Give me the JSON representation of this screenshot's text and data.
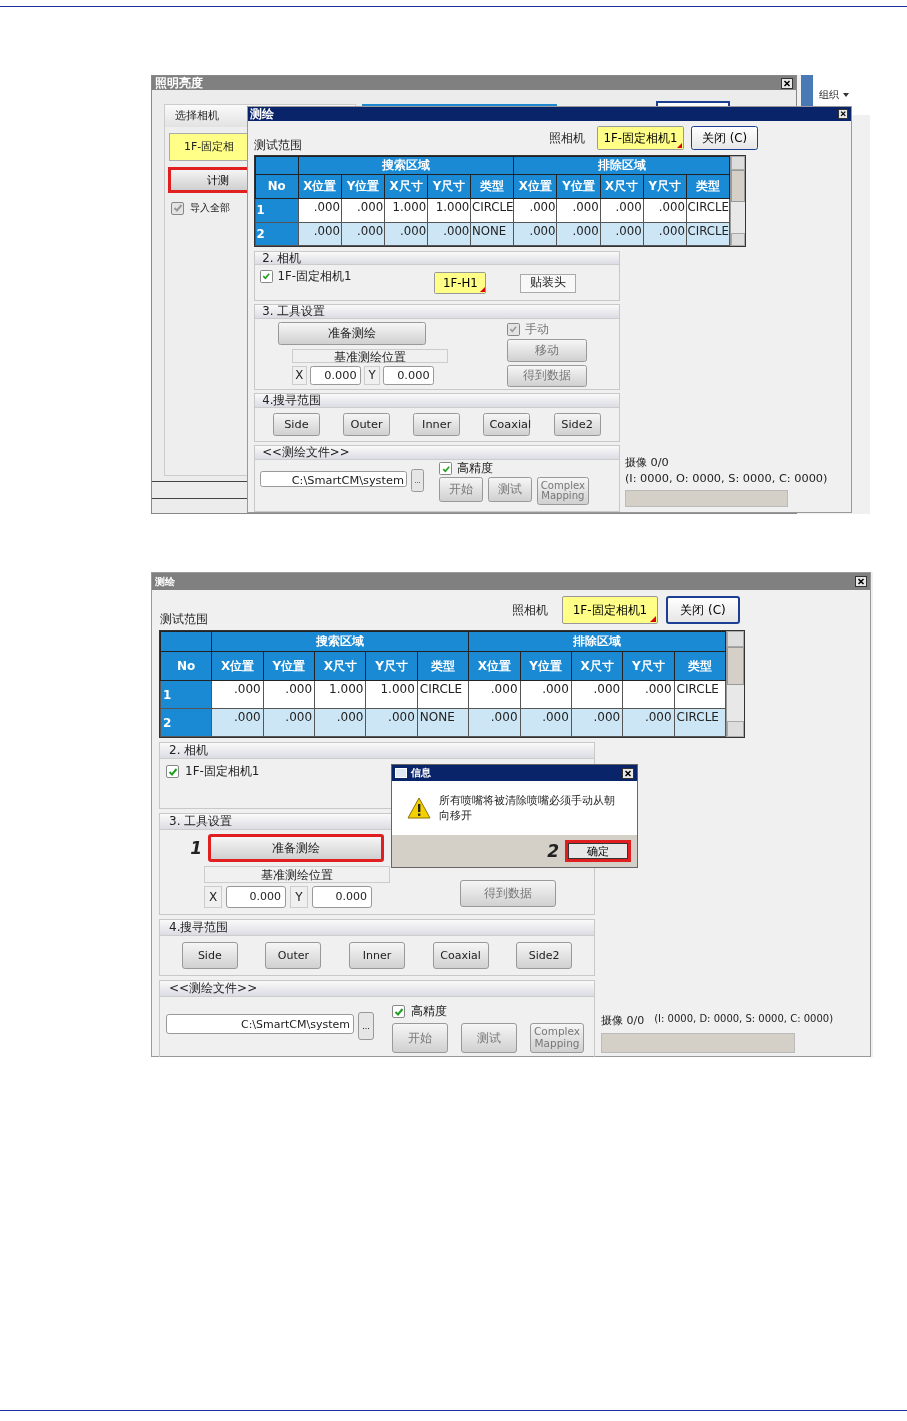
{
  "screenshots": [
    {
      "background_window": {
        "title": "照明亮度",
        "section_title": "选择相机",
        "camera": "1F-固定相",
        "measure_button": {
          "label": "计测",
          "highlighted": true
        },
        "import_all": {
          "label": "导入全部",
          "checked": true,
          "disabled": true
        }
      },
      "side_window": {
        "menu": "组织"
      },
      "dialog": {
        "title": "测绘",
        "active": true,
        "range_label": "测试范围",
        "camera_label": "照相机",
        "camera_value": "1F-固定相机1",
        "close_button": "关闭 (C)",
        "table": {
          "groups": [
            "搜索区域",
            "排除区域"
          ],
          "columns": [
            "No",
            "X位置",
            "Y位置",
            "X尺寸",
            "Y尺寸",
            "类型",
            "X位置",
            "Y位置",
            "X尺寸",
            "Y尺寸",
            "类型"
          ],
          "rows": [
            {
              "cells": [
                "1",
                ".000",
                ".000",
                "1.000",
                "1.000",
                "CIRCLE",
                ".000",
                ".000",
                ".000",
                ".000",
                "CIRCLE"
              ]
            },
            {
              "cells": [
                "2",
                ".000",
                ".000",
                ".000",
                ".000",
                "NONE",
                ".000",
                ".000",
                ".000",
                ".000",
                "CIRCLE"
              ]
            }
          ]
        },
        "camera_section": {
          "title": "2. 相机",
          "camera": {
            "label": "1F-固定相机1",
            "checked": true
          },
          "head_button": "1F-H1",
          "head_type": "贴装头"
        },
        "tool_section": {
          "title": "3. 工具设置",
          "prepare_button": {
            "label": "准备测绘",
            "highlighted": false
          },
          "reference_label": "基准测绘位置",
          "x_label": "X",
          "x_value": "0.000",
          "y_label": "Y",
          "y_value": "0.000",
          "manual": {
            "label": "手动",
            "checked": true,
            "disabled": true
          },
          "move_button": {
            "label": "移动",
            "disabled": true
          },
          "get_data_button": {
            "label": "得到数据",
            "disabled": true
          }
        },
        "search_section": {
          "title": "4.搜寻范围",
          "buttons": [
            "Side",
            "Outer",
            "Inner",
            "Coaxial",
            "Side2"
          ]
        },
        "file_section": {
          "title": "<<测绘文件>>",
          "path": "C:\\SmartCM\\system",
          "browse_button": "...",
          "high_precision": {
            "label": "高精度",
            "checked": true
          },
          "buttons": [
            {
              "label": "开始",
              "disabled": true
            },
            {
              "label": "测试",
              "disabled": true
            },
            {
              "label": "Complex Mapping",
              "disabled": true
            }
          ]
        },
        "capture_label": "摄像 0/0",
        "counts": "(I: 0000, O: 0000, S: 0000, C: 0000)",
        "progress": {
          "level": 0
        }
      }
    },
    {
      "dialog": {
        "title": "测绘",
        "active": false,
        "range_label": "测试范围",
        "camera_label": "照相机",
        "camera_value": "1F-固定相机1",
        "close_button": "关闭 (C)",
        "table": {
          "groups": [
            "搜索区域",
            "排除区域"
          ],
          "columns": [
            "No",
            "X位置",
            "Y位置",
            "X尺寸",
            "Y尺寸",
            "类型",
            "X位置",
            "Y位置",
            "X尺寸",
            "Y尺寸",
            "类型"
          ],
          "rows": [
            {
              "cells": [
                "1",
                ".000",
                ".000",
                "1.000",
                "1.000",
                "CIRCLE",
                ".000",
                ".000",
                ".000",
                ".000",
                "CIRCLE"
              ]
            },
            {
              "cells": [
                "2",
                ".000",
                ".000",
                ".000",
                ".000",
                "NONE",
                ".000",
                ".000",
                ".000",
                ".000",
                "CIRCLE"
              ]
            }
          ]
        },
        "camera_section": {
          "title": "2. 相机",
          "camera": {
            "label": "1F-固定相机1",
            "checked": true
          }
        },
        "tool_section": {
          "title": "3. 工具设置",
          "prepare_button": {
            "label": "准备测绘",
            "highlighted": true,
            "step": "1"
          },
          "reference_label": "基准测绘位置",
          "x_label": "X",
          "x_value": "0.000",
          "y_label": "Y",
          "y_value": "0.000",
          "get_data_button": {
            "label": "得到数据",
            "disabled": true
          }
        },
        "search_section": {
          "title": "4.搜寻范围",
          "buttons": [
            "Side",
            "Outer",
            "Inner",
            "Coaxial",
            "Side2"
          ]
        },
        "file_section": {
          "title": "<<测绘文件>>",
          "path": "C:\\SmartCM\\system",
          "browse_button": "...",
          "high_precision": {
            "label": "高精度",
            "checked": true
          },
          "buttons": [
            {
              "label": "开始",
              "disabled": true
            },
            {
              "label": "测试",
              "disabled": true
            },
            {
              "label": "Complex Mapping",
              "disabled": true
            }
          ]
        },
        "capture_label": "摄像 0/0",
        "counts": "(I: 0000, D: 0000, S: 0000, C: 0000)",
        "progress": {
          "level": 0
        }
      },
      "message_box": {
        "title": "信息",
        "text": "所有喷嘴将被清除喷嘴必须手动从朝向移开",
        "ok_button": {
          "label": "确定",
          "highlighted": true,
          "step": "2"
        }
      }
    }
  ]
}
